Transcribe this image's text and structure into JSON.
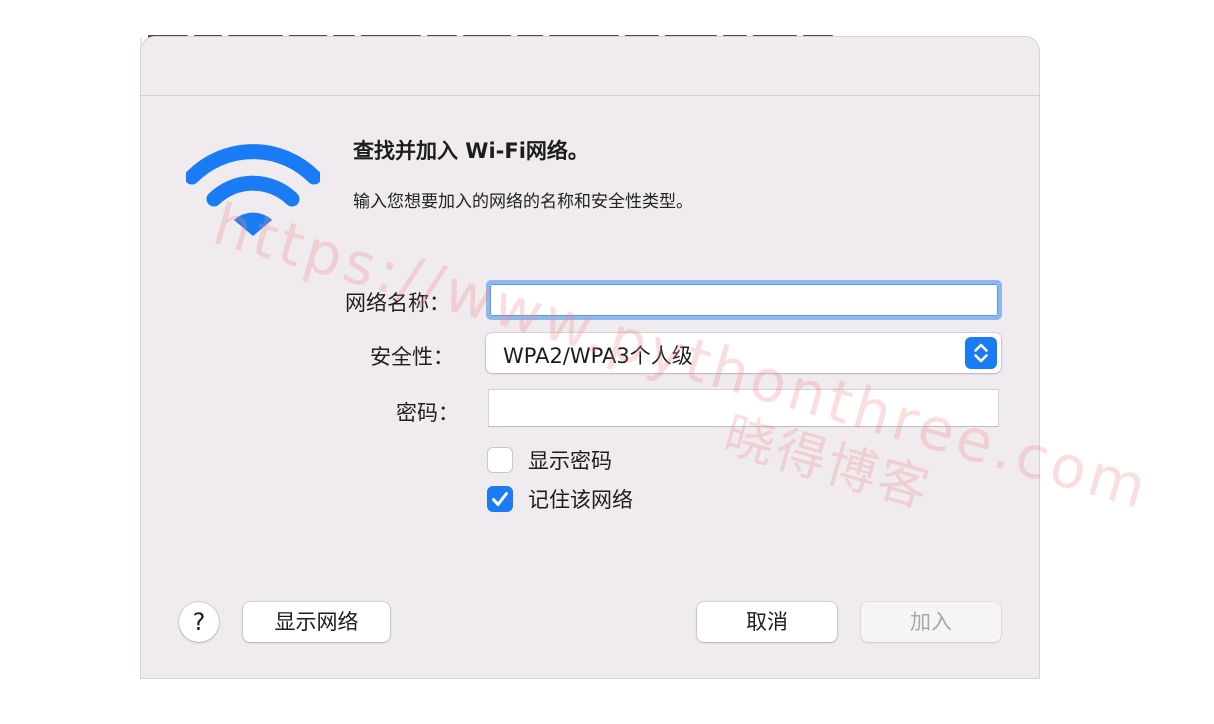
{
  "dialog": {
    "heading": "查找并加入 Wi-Fi网络。",
    "subheading": "输入您想要加入的网络的名称和安全性类型。"
  },
  "form": {
    "network_name_label": "网络名称：",
    "network_name_value": "",
    "security_label": "安全性：",
    "security_value": "WPA2/WPA3个人级",
    "password_label": "密码：",
    "password_value": ""
  },
  "options": {
    "show_password_label": "显示密码",
    "show_password_checked": false,
    "remember_network_label": "记住该网络",
    "remember_network_checked": true
  },
  "buttons": {
    "help_label": "?",
    "show_networks_label": "显示网络",
    "cancel_label": "取消",
    "join_label": "加入",
    "join_enabled": false
  },
  "watermark": {
    "url": "https://www.pythonthree.com",
    "name": "晓得博客"
  },
  "icons": {
    "wifi": "wifi-icon",
    "stepper": "updown-chevron-icon",
    "check": "checkmark-icon"
  },
  "colors": {
    "accent": "#1a7cf5",
    "dialog_background": "#efebee",
    "focus_ring": "#8cb7ef",
    "watermark": "#f08a8a"
  }
}
